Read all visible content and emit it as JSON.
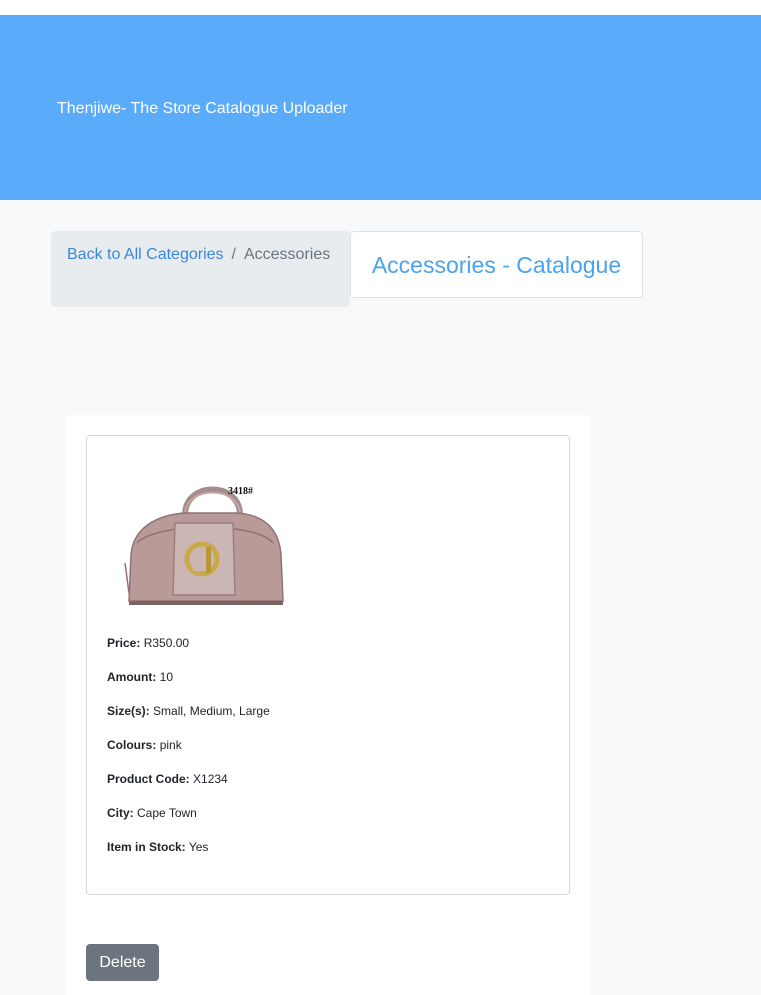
{
  "header": {
    "title": "Thenjiwe- The Store Catalogue Uploader"
  },
  "breadcrumb": {
    "back_label": "Back to All Categories",
    "separator": "/",
    "current": "Accessories"
  },
  "catalogue": {
    "heading": "Accessories - Catalogue"
  },
  "product": {
    "image_label": "3418#",
    "details": [
      {
        "label": "Price:",
        "value": "R350.00"
      },
      {
        "label": "Amount:",
        "value": "10"
      },
      {
        "label": "Size(s):",
        "value": "Small, Medium, Large"
      },
      {
        "label": "Colours:",
        "value": "pink"
      },
      {
        "label": "Product Code:",
        "value": "X1234"
      },
      {
        "label": "City:",
        "value": "Cape Town"
      },
      {
        "label": "Item in Stock:",
        "value": "Yes"
      }
    ]
  },
  "actions": {
    "delete_label": "Delete"
  },
  "colors": {
    "hero": "#5aabfa",
    "link": "#3a88d8",
    "heading": "#4aa3ee",
    "button": "#6c757d"
  }
}
